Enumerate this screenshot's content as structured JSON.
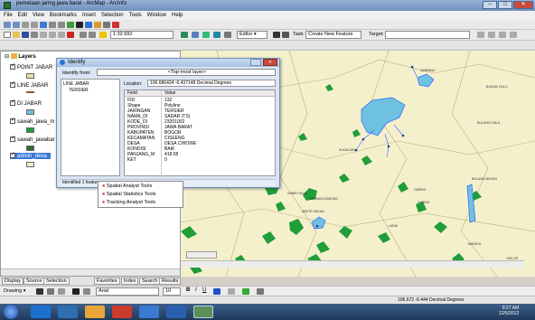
{
  "window": {
    "title": "pemetaan jaring jawa barat - ArcMap - ArcInfo",
    "min": "–",
    "max": "□",
    "close": "✕"
  },
  "menu": [
    "File",
    "Edit",
    "View",
    "Bookmarks",
    "Insert",
    "Selection",
    "Tools",
    "Window",
    "Help"
  ],
  "toolbar": {
    "scale": "1:32.692",
    "editor": "Editor ▾",
    "task_label": "Task:",
    "task_value": "Create New Feature",
    "target_label": "Target:"
  },
  "toc": {
    "root": "Layers",
    "layers": [
      {
        "name": "POINT JABAR",
        "checked": true,
        "color": "#e7e1a9"
      },
      {
        "name": "LINE JABAR",
        "checked": true,
        "color": "#8b5a2b"
      },
      {
        "name": "DI JABAR",
        "checked": true,
        "color": "#6ec1e0"
      },
      {
        "name": "sawah_jawa_m",
        "checked": true,
        "color": "#1f9e3a"
      },
      {
        "name": "sawah_jawabar",
        "checked": true,
        "color": "#2d6b2d"
      },
      {
        "name": "admin_desa",
        "checked": true,
        "color": "#f4f0c4"
      }
    ]
  },
  "identify": {
    "title": "Identify",
    "identify_from_label": "Identify from:",
    "identify_from_value": "<Top-most layer>",
    "tree_root": "LINE JABAR",
    "tree_child": "TERSIER",
    "location_label": "Location:",
    "location_value": "106.686424  -6.437148 Decimal Degrees",
    "col_field": "Field",
    "col_value": "Value",
    "rows": [
      {
        "field": "FID",
        "value": "132"
      },
      {
        "field": "Shape",
        "value": "Polyline"
      },
      {
        "field": "JARINGAN",
        "value": "TERSIER"
      },
      {
        "field": "NAMA_DI",
        "value": "SADAR (TS)"
      },
      {
        "field": "KODE_DI",
        "value": "23201002"
      },
      {
        "field": "PROVINSI",
        "value": "JAWA BARAT"
      },
      {
        "field": "KABUPATEN",
        "value": "BOGOR"
      },
      {
        "field": "KECAMATAN",
        "value": "CISEENG"
      },
      {
        "field": "DESA",
        "value": "DESA CIHOWE"
      },
      {
        "field": "KONDISI",
        "value": "BAIK"
      },
      {
        "field": "PANJANG_M",
        "value": "418.58"
      },
      {
        "field": "KET",
        "value": "0"
      }
    ],
    "status": "Identified 1 feature"
  },
  "context_menu": [
    "Spatial Analyst Tools",
    "Spatial Statistics Tools",
    "Tracking Analyst Tools"
  ],
  "map_labels": [
    "BUDAKI HULU",
    "BULANG KIDUL",
    "BULANG MEDAN",
    "CIBENG",
    "MARAYA",
    "JAMPANG",
    "SUKALURI",
    "SABEH SAYA",
    "CIBENO",
    "GANDAN DOMONG",
    "LARAI",
    "BUDIDAYA",
    "JIKILOP",
    "ABUTE SADAN"
  ],
  "tabs": {
    "bottom_left": [
      "Display",
      "Source",
      "Selection"
    ],
    "bottom_right": [
      "Favorites",
      "Index",
      "Search",
      "Results"
    ]
  },
  "drawbar": {
    "drawing": "Drawing ▾",
    "font": "Arial",
    "size": "10"
  },
  "status": {
    "coords": "106.672  -6.444 Decimal Degrees"
  },
  "taskbar": {
    "time": "8:27 AM",
    "date": "12/5/2012"
  },
  "colors": {
    "map_bg": "#f5f0cc",
    "paddy": "#1f9e3a",
    "water": "#6ec1e0",
    "selection": "#2f63ff"
  }
}
